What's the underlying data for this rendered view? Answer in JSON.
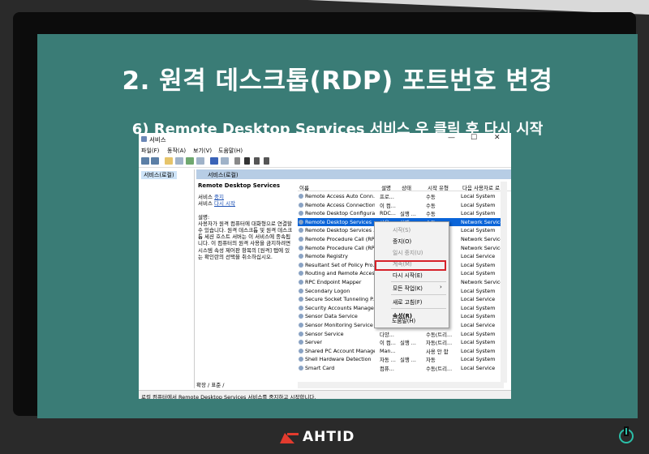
{
  "slide": {
    "title": "2. 원격 데스크톱(RDP) 포트번호 변경",
    "subtitle": "6) Remote Desktop Services 서비스 우 클릭 후 다시 시작"
  },
  "brand": {
    "name": "AHTID",
    "accent": "#e23b2e"
  },
  "colors": {
    "screen_bg": "#3a7c76",
    "selection": "#0a64d8",
    "highlight_box": "#d6222a"
  },
  "window": {
    "title": "서비스",
    "controls": [
      "—",
      "☐",
      "✕"
    ],
    "menu": [
      "파일(F)",
      "동작(A)",
      "보기(V)",
      "도움말(H)"
    ],
    "tree_node": "서비스(로컬)",
    "pane_header": "서비스(로컬)",
    "description": {
      "service_name": "Remote Desktop Services",
      "stop_prefix": "서비스 ",
      "stop_link": "중지",
      "restart_prefix": "서비스 ",
      "restart_link": "다시 시작",
      "label": "설명:",
      "text": "사용자가 원격 컴퓨터에 대화형으로 연결할 수 있습니다. 원격 데스크톱 및 원격 데스크톱 세션 호스트 서버는 이 서비스에 종속됩니다. 이 컴퓨터의 원격 사용을 금지하려면 시스템 속성 제어판 항목의 [원격] 탭에 있는 확인란의 선택을 취소하십시오."
    },
    "columns": [
      "이름",
      "설명",
      "상태",
      "시작 유형",
      "다음 사용자로 로"
    ],
    "rows": [
      {
        "name": "Remote Access Auto Conn...",
        "desc": "프로...",
        "status": "",
        "startup": "수동",
        "logon": "Local System"
      },
      {
        "name": "Remote Access Connection...",
        "desc": "이 컴...",
        "status": "",
        "startup": "수동",
        "logon": "Local System"
      },
      {
        "name": "Remote Desktop Configura...",
        "desc": "RDC...",
        "status": "실행 ...",
        "startup": "수동",
        "logon": "Local System"
      },
      {
        "name": "Remote Desktop Services",
        "desc": "사용...",
        "status": "실행 ...",
        "startup": "수동",
        "logon": "Network Service"
      },
      {
        "name": "Remote Desktop Services ...",
        "desc": "",
        "status": "",
        "startup": "",
        "logon": "Local System"
      },
      {
        "name": "Remote Procedure Call (RP...",
        "desc": "",
        "status": "",
        "startup": "",
        "logon": "Network Service"
      },
      {
        "name": "Remote Procedure Call (RP...",
        "desc": "",
        "status": "",
        "startup": "",
        "logon": "Network Service"
      },
      {
        "name": "Remote Registry",
        "desc": "",
        "status": "",
        "startup": "",
        "logon": "Local Service"
      },
      {
        "name": "Resultant Set of Policy Pro...",
        "desc": "",
        "status": "",
        "startup": "",
        "logon": "Local System"
      },
      {
        "name": "Routing and Remote Acces...",
        "desc": "",
        "status": "",
        "startup": "",
        "logon": "Local System"
      },
      {
        "name": "RPC Endpoint Mapper",
        "desc": "",
        "status": "",
        "startup": "",
        "logon": "Network Service"
      },
      {
        "name": "Secondary Logon",
        "desc": "",
        "status": "",
        "startup": "",
        "logon": "Local System"
      },
      {
        "name": "Secure Socket Tunneling P...",
        "desc": "",
        "status": "",
        "startup": "",
        "logon": "Local Service"
      },
      {
        "name": "Security Accounts Manager",
        "desc": "",
        "status": "",
        "startup": "",
        "logon": "Local System"
      },
      {
        "name": "Sensor Data Service",
        "desc": "",
        "status": "",
        "startup": "",
        "logon": "Local System"
      },
      {
        "name": "Sensor Monitoring Service",
        "desc": "",
        "status": "",
        "startup": "",
        "logon": "Local Service"
      },
      {
        "name": "Sensor Service",
        "desc": "다양...",
        "status": "",
        "startup": "수동(트리...",
        "logon": "Local System"
      },
      {
        "name": "Server",
        "desc": "이 컴...",
        "status": "실행 ...",
        "startup": "자동(트리...",
        "logon": "Local System"
      },
      {
        "name": "Shared PC Account Manager",
        "desc": "Man...",
        "status": "",
        "startup": "사용 안 함",
        "logon": "Local System"
      },
      {
        "name": "Shell Hardware Detection",
        "desc": "자동 ...",
        "status": "실행 ...",
        "startup": "자동",
        "logon": "Local System"
      },
      {
        "name": "Smart Card",
        "desc": "컴퓨...",
        "status": "",
        "startup": "수동(트리...",
        "logon": "Local Service"
      }
    ],
    "context_menu": [
      "시작(S)",
      "중지(O)",
      "일시 중지(U)",
      "계속(M)",
      "다시 시작(E)",
      "모든 작업(K)",
      "새로 고침(F)",
      "속성(R)",
      "도움말(H)"
    ],
    "tabs": "확장 / 표준 /",
    "status": "로컬 컴퓨터에서 Remote Desktop Services 서비스를 중지하고 시작합니다."
  }
}
